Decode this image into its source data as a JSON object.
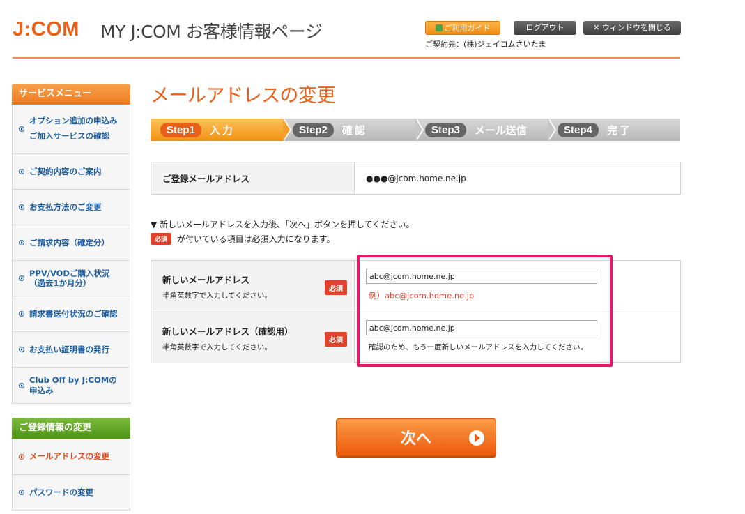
{
  "header": {
    "logo": "J:COM",
    "site_title": "MY J:COM お客様情報ページ",
    "guide_button": "ご利用ガイド",
    "logout_button": "ログアウト",
    "close_button": "✕ ウィンドウを閉じる",
    "contract_label": "ご契約先：(株)ジェイコムさいたま"
  },
  "sidebar": {
    "service_menu_title": "サービスメニュー",
    "service_items": [
      {
        "label": "オプション追加の申込み\nご加入サービスの確認"
      },
      {
        "label": "ご契約内容のご案内"
      },
      {
        "label": "お支払方法のご変更"
      },
      {
        "label": "ご請求内容（確定分）"
      },
      {
        "label": "PPV/VODご購入状況\n（過去1か月分）"
      },
      {
        "label": "請求書送付状況のご確認"
      },
      {
        "label": "お支払い証明書の発行"
      },
      {
        "label": "Club Off by J:COMの\n申込み"
      }
    ],
    "registration_title": "ご登録情報の変更",
    "registration_items": [
      {
        "label": "メールアドレスの変更"
      },
      {
        "label": "パスワードの変更"
      }
    ]
  },
  "main": {
    "page_title": "メールアドレスの変更",
    "steps": [
      {
        "num": "Step1",
        "name": "入力"
      },
      {
        "num": "Step2",
        "name": "確認"
      },
      {
        "num": "Step3",
        "name": "メール送信"
      },
      {
        "num": "Step4",
        "name": "完了"
      }
    ],
    "registered_label": "ご登録メールアドレス",
    "registered_value": "●●●@jcom.home.ne.jp",
    "note1": "▼ 新しいメールアドレスを入力後、「次へ」ボタンを押してください。",
    "note2_badge": "必須",
    "note2_text": "が付いている項目は必須入力になります。",
    "form": {
      "new_email_label": "新しいメールアドレス",
      "new_email_sub": "半角英数字で入力してください。",
      "required_badge": "必須",
      "new_email_value": "abc@jcom.home.ne.jp",
      "example": "例）abc@jcom.home.ne.jp",
      "confirm_label": "新しいメールアドレス（確認用）",
      "confirm_sub": "半角英数字で入力してください。",
      "confirm_value": "abc@jcom.home.ne.jp",
      "confirm_note": "確認のため、もう一度新しいメールアドレスを入力してください。"
    },
    "next_button": "次へ"
  },
  "colors": {
    "brand_orange": "#e8611a",
    "highlight": "#e8176a",
    "link_blue": "#1f5fa0"
  }
}
